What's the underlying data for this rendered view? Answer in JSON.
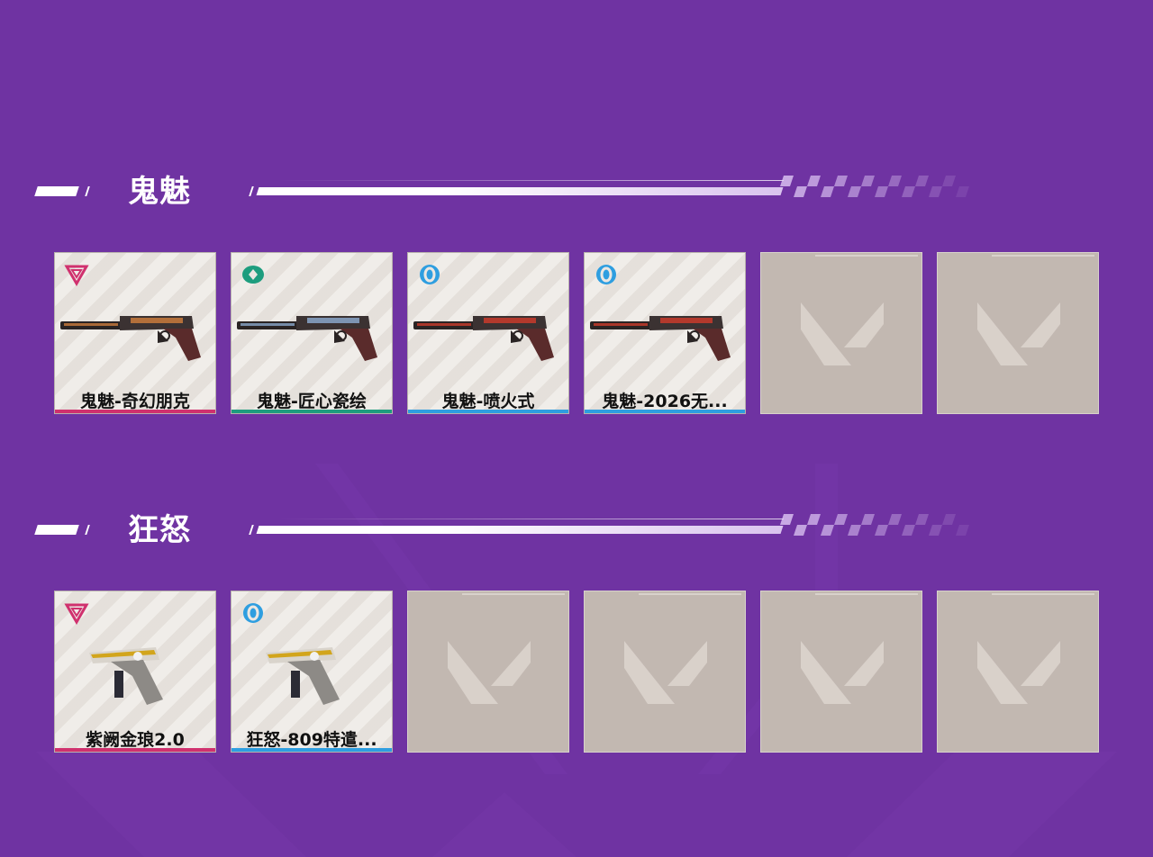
{
  "colors": {
    "background": "#6f33a2",
    "rarity_exclusive": "#d0316e",
    "rarity_premium": "#1d9d7e",
    "rarity_deluxe": "#2e9ee0",
    "empty_slot": "#c2b8b1"
  },
  "sections": [
    {
      "title": "鬼魅",
      "items": [
        {
          "name": "鬼魅-奇幻朋克",
          "tier": "exclusive",
          "tier_icon": "triangle-tier-icon",
          "weapon": "ghost-pistol-icon",
          "rarity_color": "#d0316e"
        },
        {
          "name": "鬼魅-匠心瓷绘",
          "tier": "premium",
          "tier_icon": "diamond-tier-icon",
          "weapon": "ghost-pistol-icon",
          "rarity_color": "#1d9d7e"
        },
        {
          "name": "鬼魅-喷火式",
          "tier": "deluxe",
          "tier_icon": "ring-tier-icon",
          "weapon": "ghost-pistol-icon",
          "rarity_color": "#2e9ee0"
        },
        {
          "name": "鬼魅-2026无...",
          "tier": "deluxe",
          "tier_icon": "ring-tier-icon",
          "weapon": "ghost-pistol-icon",
          "rarity_color": "#2e9ee0"
        }
      ],
      "empty_slots": 2
    },
    {
      "title": "狂怒",
      "items": [
        {
          "name": "紫阙金琅2.0",
          "tier": "exclusive",
          "tier_icon": "triangle-tier-icon",
          "weapon": "frenzy-pistol-icon",
          "rarity_color": "#d0316e"
        },
        {
          "name": "狂怒-809特遣...",
          "tier": "deluxe",
          "tier_icon": "ring-tier-icon",
          "weapon": "frenzy-pistol-icon",
          "rarity_color": "#2e9ee0"
        }
      ],
      "empty_slots": 4
    }
  ]
}
